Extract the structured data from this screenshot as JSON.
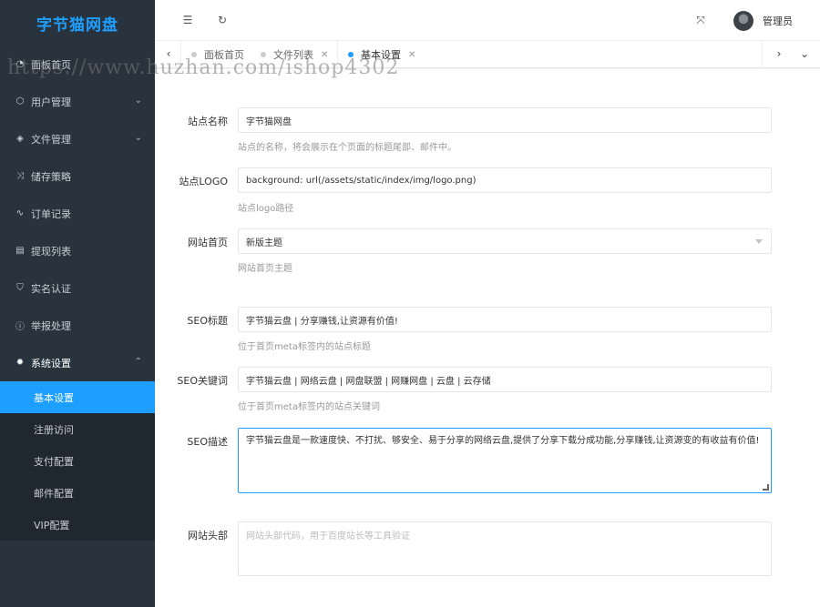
{
  "brand": "字节猫网盘",
  "sidebar": {
    "items": [
      {
        "label": "面板首页",
        "icon": "dashboard-icon"
      },
      {
        "label": "用户管理",
        "icon": "box-icon",
        "chevron": "down"
      },
      {
        "label": "文件管理",
        "icon": "layers-icon",
        "chevron": "down"
      },
      {
        "label": "储存策略",
        "icon": "shuffle-icon"
      },
      {
        "label": "订单记录",
        "icon": "pulse-icon"
      },
      {
        "label": "提现列表",
        "icon": "list-icon"
      },
      {
        "label": "实名认证",
        "icon": "shield-icon"
      },
      {
        "label": "举报处理",
        "icon": "info-icon"
      },
      {
        "label": "系统设置",
        "icon": "gear-icon",
        "chevron": "up"
      }
    ],
    "sub_items": [
      {
        "label": "基本设置",
        "active": true
      },
      {
        "label": "注册访问"
      },
      {
        "label": "支付配置"
      },
      {
        "label": "邮件配置"
      },
      {
        "label": "VIP配置"
      }
    ]
  },
  "header": {
    "user_name": "管理员"
  },
  "tabs": [
    {
      "label": "面板首页"
    },
    {
      "label": "文件列表",
      "closable": true
    },
    {
      "label": "基本设置",
      "closable": true,
      "active": true
    }
  ],
  "form": {
    "site_name": {
      "label": "站点名称",
      "value": "字节猫网盘",
      "help": "站点的名称，将会展示在个页面的标题尾部、邮件中。"
    },
    "site_logo": {
      "label": "站点LOGO",
      "value": "background: url(/assets/static/index/img/logo.png)",
      "help": "站点logo路径"
    },
    "homepage": {
      "label": "网站首页",
      "value": "新版主题",
      "help": "网站首页主题"
    },
    "seo_title": {
      "label": "SEO标题",
      "value": "字节猫云盘 | 分享赚钱,让资源有价值!",
      "help": "位于首页meta标签内的站点标题"
    },
    "seo_keywords": {
      "label": "SEO关键词",
      "value": "字节猫云盘 | 网络云盘 | 网盘联盟 | 网赚网盘 | 云盘 | 云存储",
      "help": "位于首页meta标签内的站点关键词"
    },
    "seo_description": {
      "label": "SEO描述",
      "value": "字节猫云盘是一款速度快、不打扰、够安全、易于分享的网络云盘,提供了分享下载分成功能,分享赚钱,让资源变的有收益有价值!"
    },
    "site_header": {
      "label": "网站头部",
      "placeholder": "网站头部代码，用于百度站长等工具验证"
    }
  },
  "watermark": "https://www.huzhan.com/ishop4302"
}
